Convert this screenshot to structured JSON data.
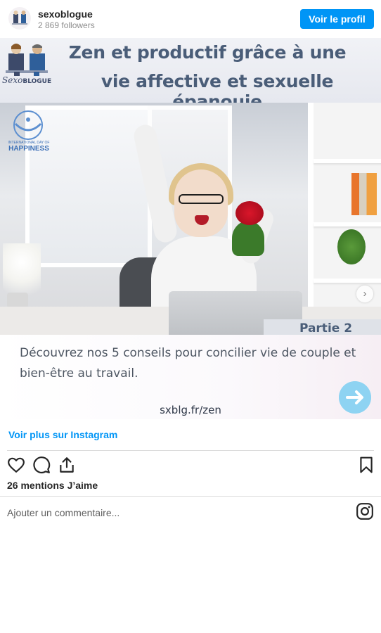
{
  "header": {
    "username": "sexoblogue",
    "followers": "2 869 followers",
    "profile_button": "Voir le profil"
  },
  "post": {
    "title_line1": "Zen et productif grâce à une",
    "title_line2": "vie affective et sexuelle épanouie",
    "brand_name": "Sexo",
    "brand_name_bold": "BLOGUE",
    "happiness_small": "INTERNATIONAL DAY OF",
    "happiness_big": "HAPPINESS",
    "partie": "Partie 2",
    "description": "Découvrez nos 5 conseils pour concilier vie de couple et bien-être au travail.",
    "url": "sxblg.fr/zen"
  },
  "see_more": "Voir plus sur Instagram",
  "likes": "26 mentions J’aime",
  "comment_placeholder": "Ajouter un commentaire...",
  "icons": {
    "like": "heart-icon",
    "comment": "comment-icon",
    "share": "share-icon",
    "save": "bookmark-icon",
    "instagram": "instagram-icon",
    "next": "chevron-right-icon"
  },
  "colors": {
    "accent": "#0095f6",
    "title": "#4a5d78"
  }
}
